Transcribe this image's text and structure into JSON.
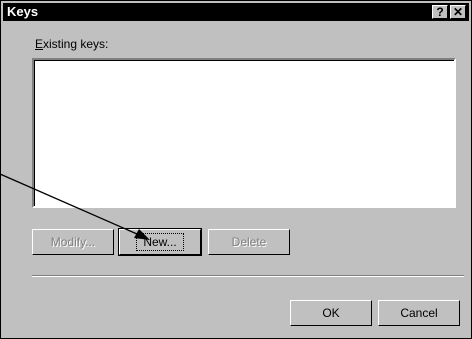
{
  "dialog": {
    "title": "Keys",
    "help_glyph": "?",
    "close_glyph": "✕"
  },
  "main": {
    "existing_keys_label_accel": "E",
    "existing_keys_label_rest": "xisting keys:",
    "items": []
  },
  "buttons": {
    "modify": "Modify...",
    "new": "New...",
    "delete": "Delete",
    "ok": "OK",
    "cancel": "Cancel"
  },
  "annotation": {
    "icon": "pointer-arrow-icon"
  }
}
